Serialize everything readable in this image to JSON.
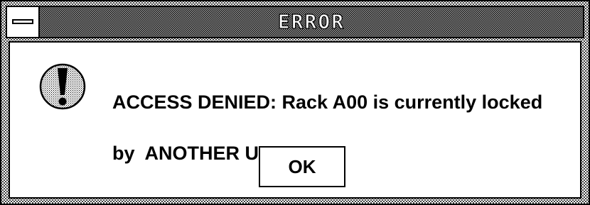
{
  "window": {
    "title": "ERROR",
    "system_menu_icon": "system-menu-icon"
  },
  "dialog": {
    "icon": "exclamation-icon",
    "message_line1": "ACCESS DENIED: Rack A00 is currently locked",
    "message_line2": "by  ANOTHER USER.",
    "ok_label": "OK"
  }
}
